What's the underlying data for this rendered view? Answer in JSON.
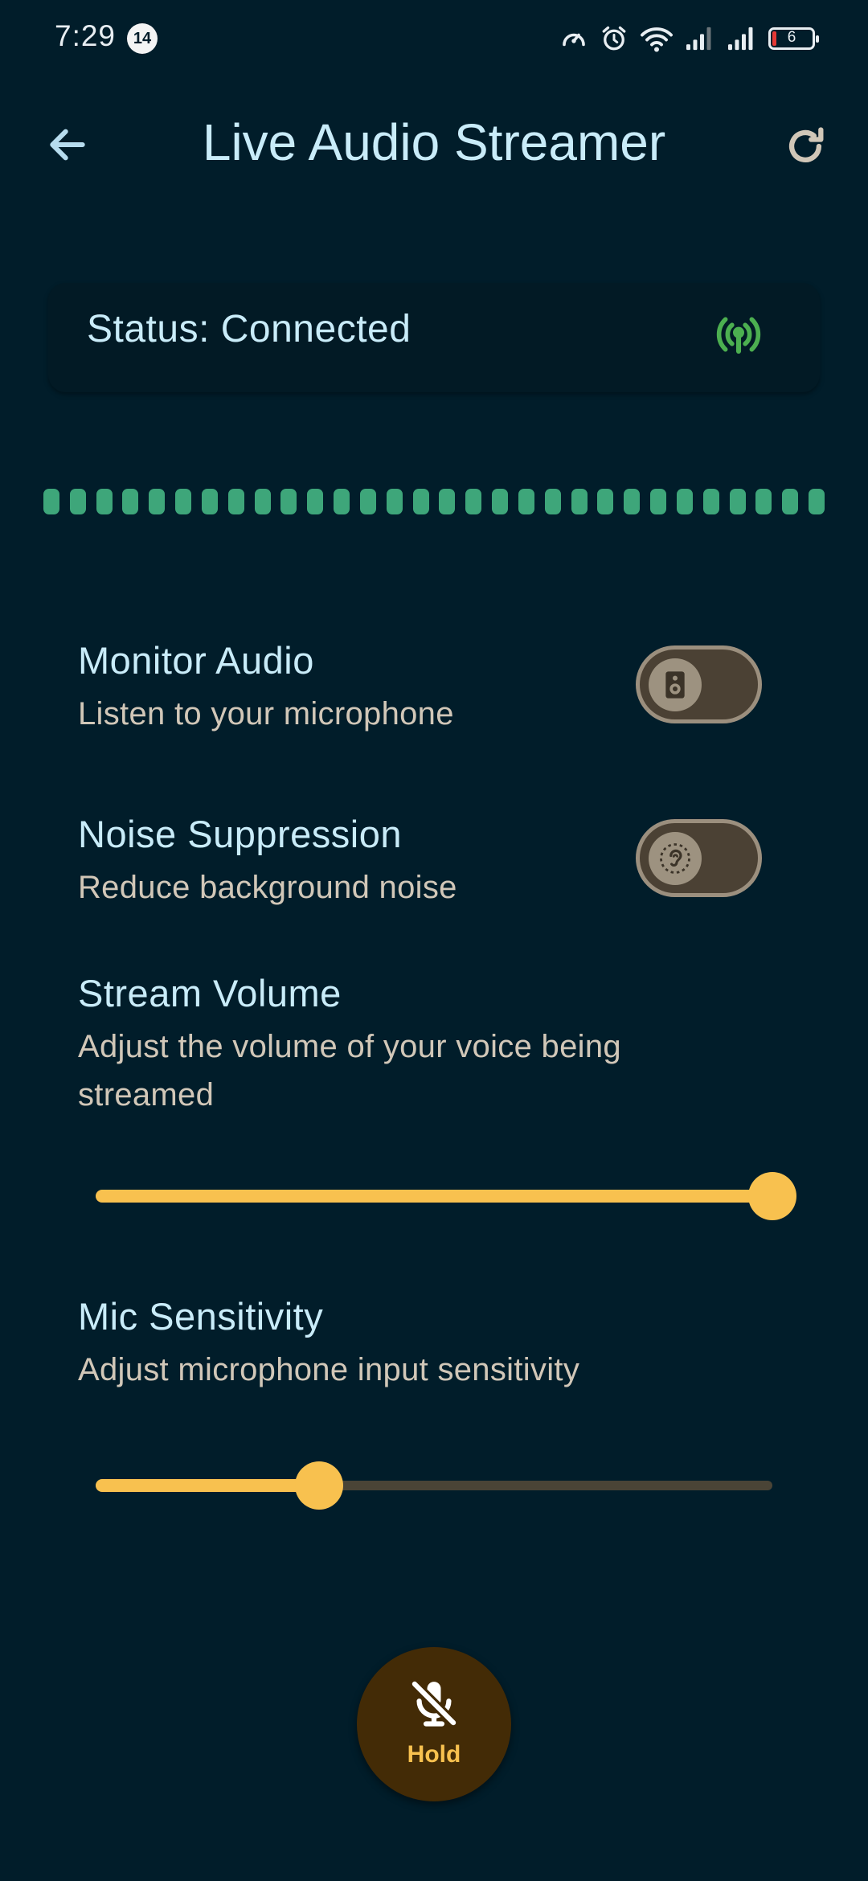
{
  "status_bar": {
    "time": "7:29",
    "notification_count": "14",
    "battery_level": "6",
    "icons": [
      "speedometer-icon",
      "alarm-icon",
      "wifi-icon",
      "cell-signal-icon",
      "cell-signal-icon",
      "battery-icon"
    ]
  },
  "app_bar": {
    "title": "Live Audio Streamer",
    "back_icon": "arrow-back-icon",
    "refresh_icon": "refresh-icon"
  },
  "status_card": {
    "text": "Status: Connected",
    "icon": "broadcast-tower-icon",
    "icon_color": "#4caf50"
  },
  "level_meter": {
    "segments": 30,
    "active_segments": 30,
    "color": "#3ea67a"
  },
  "settings": {
    "monitor_audio": {
      "title": "Monitor Audio",
      "subtitle": "Listen to your microphone",
      "enabled": false,
      "thumb_icon": "speaker-icon"
    },
    "noise_suppression": {
      "title": "Noise Suppression",
      "subtitle": "Reduce background noise",
      "enabled": false,
      "thumb_icon": "hearing-icon"
    },
    "stream_volume": {
      "title": "Stream Volume",
      "subtitle": "Adjust the volume of your voice being streamed",
      "value": 1.0
    },
    "mic_sensitivity": {
      "title": "Mic Sensitivity",
      "subtitle": "Adjust microphone input sensitivity",
      "value": 0.33
    }
  },
  "hold_button": {
    "label": "Hold",
    "icon": "mic-off-icon"
  },
  "colors": {
    "background": "#011d2a",
    "accent": "#f8c14f",
    "text_primary": "#c9ecf9",
    "text_secondary": "#d1c7b8",
    "hold_button_bg": "#432b06"
  }
}
